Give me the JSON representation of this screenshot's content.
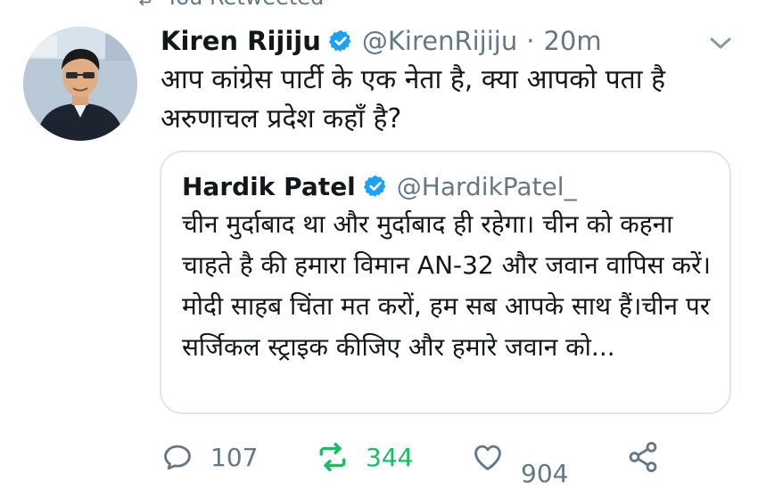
{
  "retweet_context": {
    "label": "You Retweeted"
  },
  "tweet": {
    "author_name": "Kiren Rijiju",
    "handle": "@KirenRijiju",
    "separator": "·",
    "time": "20m",
    "text": "आप कांग्रेस पार्टी के एक नेता है, क्या आपको पता है अरुणाचल प्रदेश कहाँ है?"
  },
  "quoted_tweet": {
    "author_name": "Hardik Patel",
    "handle": "@HardikPatel_",
    "text": "चीन मुर्दाबाद था और मुर्दाबाद ही रहेगा। चीन को कहना चाहते है की हमारा विमान AN-32 और जवान वापिस करें। मोदी साहब चिंता मत करों, हम सब आपके साथ हैं।चीन पर सर्जिकल स्ट्राइक कीजिए और हमारे जवान को..."
  },
  "actions": {
    "reply_count": "107",
    "retweet_count": "344",
    "like_count": "904"
  },
  "colors": {
    "accent": "#1da1f2",
    "retweeted": "#17bf63",
    "muted": "#657786",
    "text": "#14171a",
    "border": "#dfe5ea"
  },
  "icons": {
    "retweet_context": "retweet-icon",
    "verified": "verified-badge-icon",
    "caret": "chevron-down-icon",
    "reply": "reply-icon",
    "retweet": "retweet-icon",
    "like": "heart-icon",
    "share": "share-icon"
  }
}
